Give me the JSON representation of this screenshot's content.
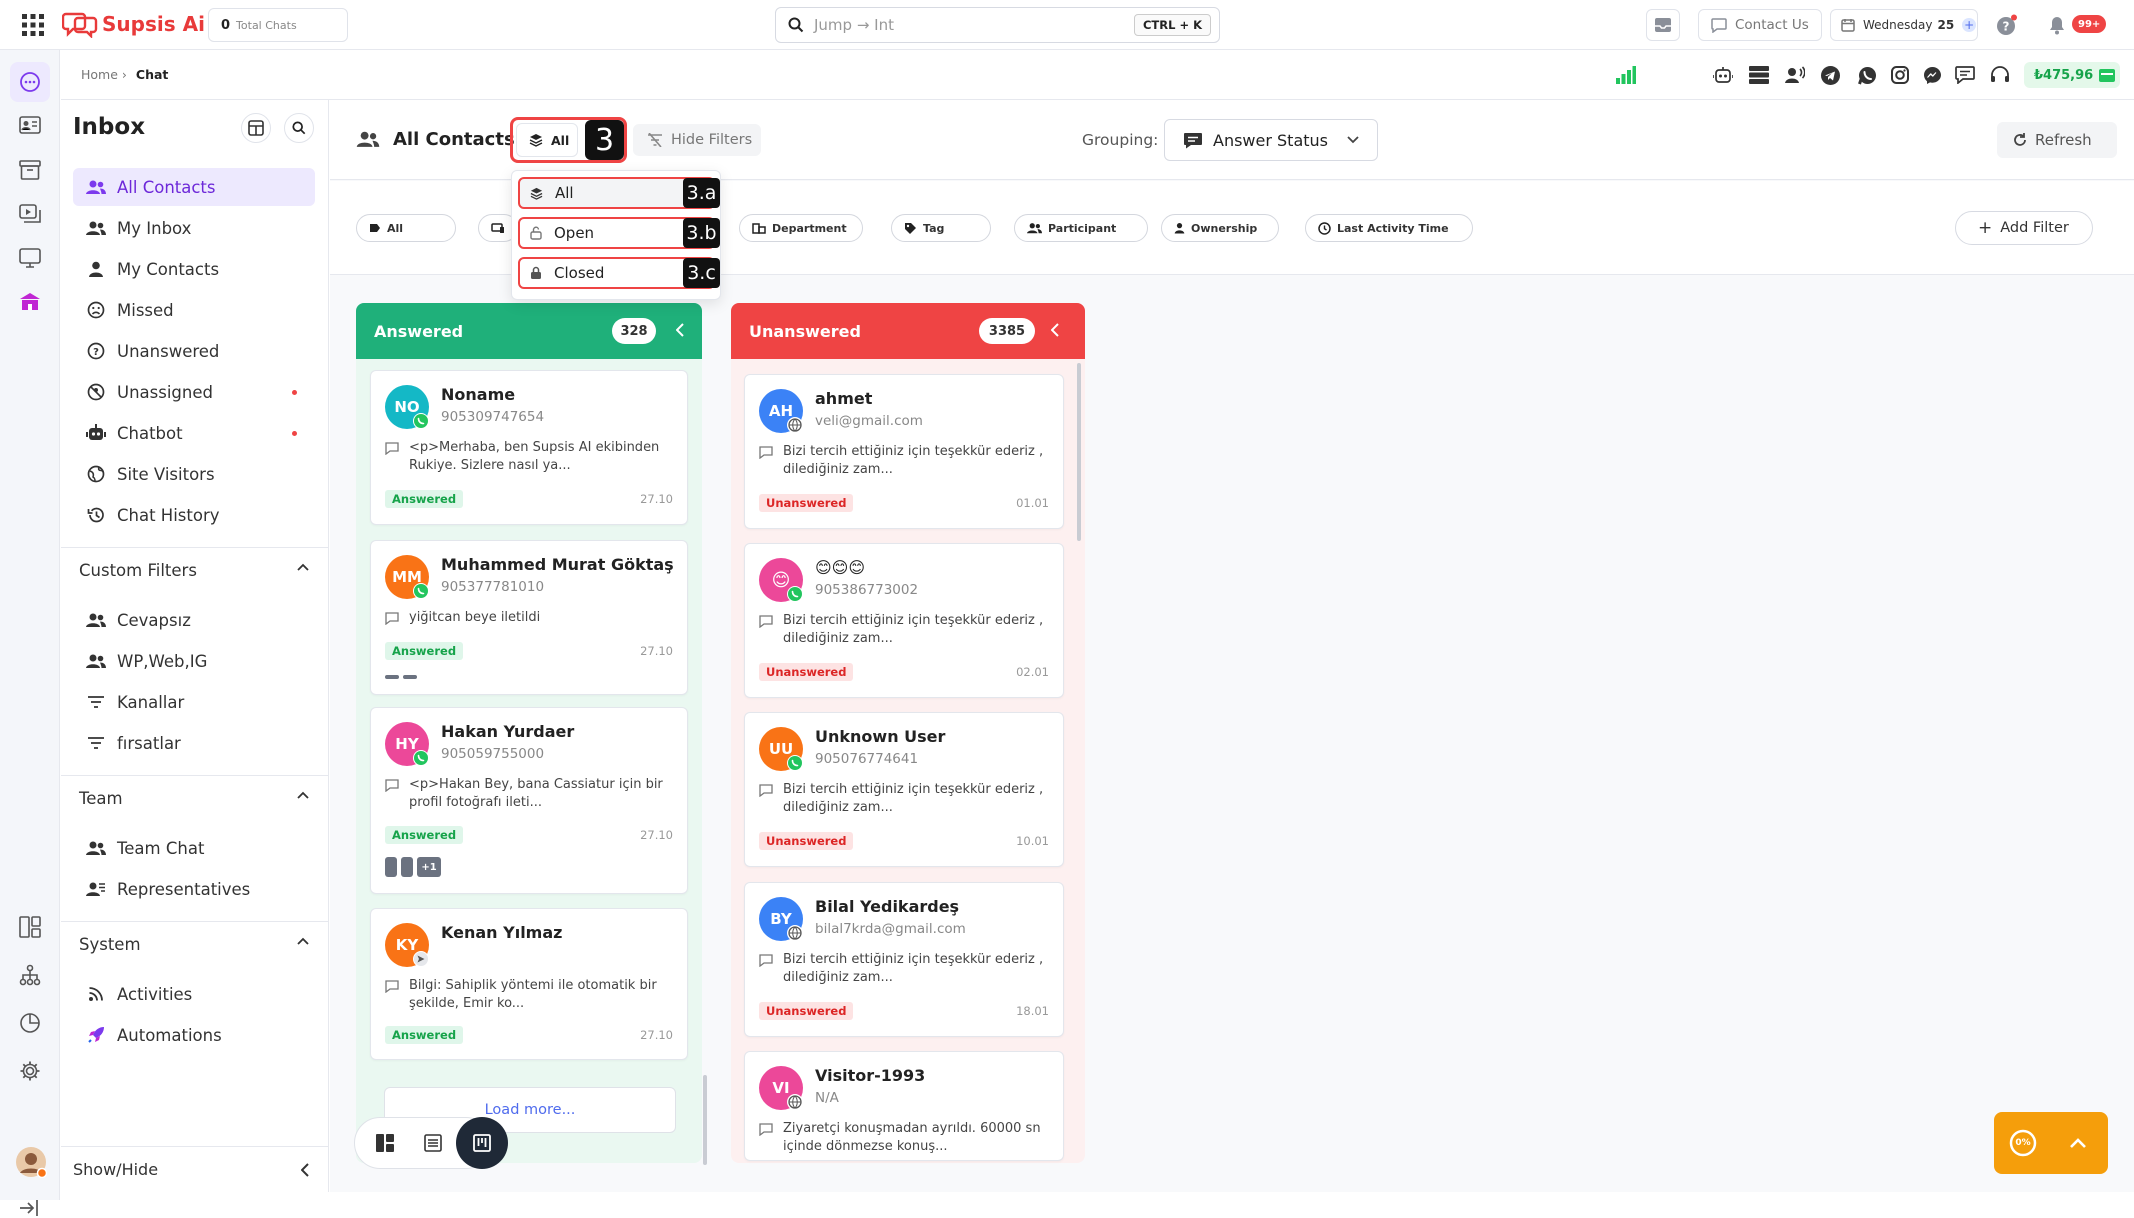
{
  "app": {
    "name": "Supsis Ai",
    "brand_color": "#e83a3a",
    "accent": "#7c3aed"
  },
  "topbar": {
    "total_chats": "0",
    "total_chats_label": "Total Chats",
    "search_value": "Jump → Int",
    "search_shortcut": "CTRL + K",
    "contact_us": "Contact Us",
    "date_label": "Wednesday",
    "date_day": "25",
    "notif_count": "99+"
  },
  "breadcrumb": {
    "home": "Home",
    "sep": "›",
    "current": "Chat"
  },
  "balance": "₺475,96",
  "sidebar": {
    "title": "Inbox",
    "items": [
      {
        "label": "All Contacts",
        "icon": "users-icon",
        "active": true
      },
      {
        "label": "My Inbox",
        "icon": "users-icon"
      },
      {
        "label": "My Contacts",
        "icon": "user-icon"
      },
      {
        "label": "Missed",
        "icon": "sad-face-icon"
      },
      {
        "label": "Unanswered",
        "icon": "question-icon"
      },
      {
        "label": "Unassigned",
        "icon": "block-icon",
        "dot": true
      },
      {
        "label": "Chatbot",
        "icon": "robot-icon",
        "dot": true
      },
      {
        "label": "Site Visitors",
        "icon": "globe-icon"
      },
      {
        "label": "Chat History",
        "icon": "history-icon"
      }
    ],
    "custom_filters": {
      "title": "Custom Filters",
      "items": [
        {
          "label": "Cevapsız",
          "icon": "users-icon"
        },
        {
          "label": "WP,Web,IG",
          "icon": "users-icon"
        },
        {
          "label": "Kanallar",
          "icon": "filter-icon"
        },
        {
          "label": "fırsatlar",
          "icon": "filter-icon"
        }
      ]
    },
    "team": {
      "title": "Team",
      "items": [
        {
          "label": "Team Chat",
          "icon": "users-icon"
        },
        {
          "label": "Representatives",
          "icon": "representative-icon"
        }
      ]
    },
    "system": {
      "title": "System",
      "items": [
        {
          "label": "Activities",
          "icon": "rss-icon"
        },
        {
          "label": "Automations",
          "icon": "rocket-icon"
        }
      ]
    },
    "show_hide": "Show/Hide"
  },
  "main": {
    "title": "All Contacts",
    "status_button": "All",
    "hide_filters": "Hide Filters",
    "grouping_label": "Grouping:",
    "grouping_value": "Answer Status",
    "refresh": "Refresh",
    "add_filter": "Add Filter",
    "chips": [
      "All",
      "",
      "Department",
      "Tag",
      "Participant",
      "Ownership",
      "Last Activity Time"
    ],
    "dropdown": [
      "All",
      "Open",
      "Closed"
    ],
    "labels": {
      "main": "3",
      "a": "3.a",
      "b": "3.b",
      "c": "3.c"
    },
    "load_more": "Load more...",
    "progress": "0%"
  },
  "columns": [
    {
      "title": "Answered",
      "count": "328",
      "color": "#1fb07a",
      "cards": [
        {
          "initials": "NO",
          "name": "Noname",
          "sub": "905309747654",
          "msg": "<p>Merhaba, ben Supsis AI ekibinden Rukiye. Sizlere nasıl ya...",
          "status": "Answered",
          "date": "27.10",
          "avatar_color": "#14b8c6",
          "channel": "whatsapp-icon"
        },
        {
          "initials": "MM",
          "name": "Muhammed Murat Göktaş",
          "sub": "905377781010",
          "msg": "yiğitcan beye iletildi",
          "status": "Answered",
          "date": "27.10",
          "avatar_color": "#f97316",
          "channel": "whatsapp-icon"
        },
        {
          "initials": "HY",
          "name": "Hakan Yurdaer",
          "sub": "905059755000",
          "msg": "<p>Hakan Bey, bana Cassiatur için bir profil fotoğrafı ileti...",
          "status": "Answered",
          "date": "27.10",
          "avatar_color": "#ec4899",
          "channel": "whatsapp-icon",
          "extra": "+1"
        },
        {
          "initials": "KY",
          "name": "Kenan Yılmaz",
          "sub": "",
          "msg": "Bilgi: Sahiplik yöntemi ile otomatik bir şekilde, Emir ko...",
          "status": "Answered",
          "date": "27.10",
          "avatar_color": "#f97316",
          "channel": "send-icon"
        }
      ]
    },
    {
      "title": "Unanswered",
      "count": "3385",
      "color": "#ef4444",
      "cards": [
        {
          "initials": "AH",
          "name": "ahmet",
          "sub": "veli@gmail.com",
          "msg": "Bizi tercih ettiğiniz için teşekkür ederiz , dilediğiniz zam...",
          "status": "Unanswered",
          "date": "01.01",
          "avatar_color": "#3b82f6",
          "channel": "globe-icon"
        },
        {
          "initials": "😊",
          "name": "😊😊😊",
          "sub": "905386773002",
          "msg": "Bizi tercih ettiğiniz için teşekkür ederiz , dilediğiniz zam...",
          "status": "Unanswered",
          "date": "02.01",
          "avatar_color": "#ec4899",
          "channel": "whatsapp-icon"
        },
        {
          "initials": "UU",
          "name": "Unknown User",
          "sub": "905076774641",
          "msg": "Bizi tercih ettiğiniz için teşekkür ederiz , dilediğiniz zam...",
          "status": "Unanswered",
          "date": "10.01",
          "avatar_color": "#f97316",
          "channel": "whatsapp-icon"
        },
        {
          "initials": "BY",
          "name": "Bilal Yedikardeş",
          "sub": "bilal7krda@gmail.com",
          "msg": "Bizi tercih ettiğiniz için teşekkür ederiz , dilediğiniz zam...",
          "status": "Unanswered",
          "date": "18.01",
          "avatar_color": "#3b82f6",
          "channel": "globe-icon"
        },
        {
          "initials": "VI",
          "name": "Visitor-1993",
          "sub": "N/A",
          "msg": "Ziyaretçi konuşmadan ayrıldı. 60000 sn içinde dönmezse konuş...",
          "status": "",
          "date": "",
          "avatar_color": "#ec4899",
          "channel": "globe-icon"
        }
      ]
    }
  ]
}
